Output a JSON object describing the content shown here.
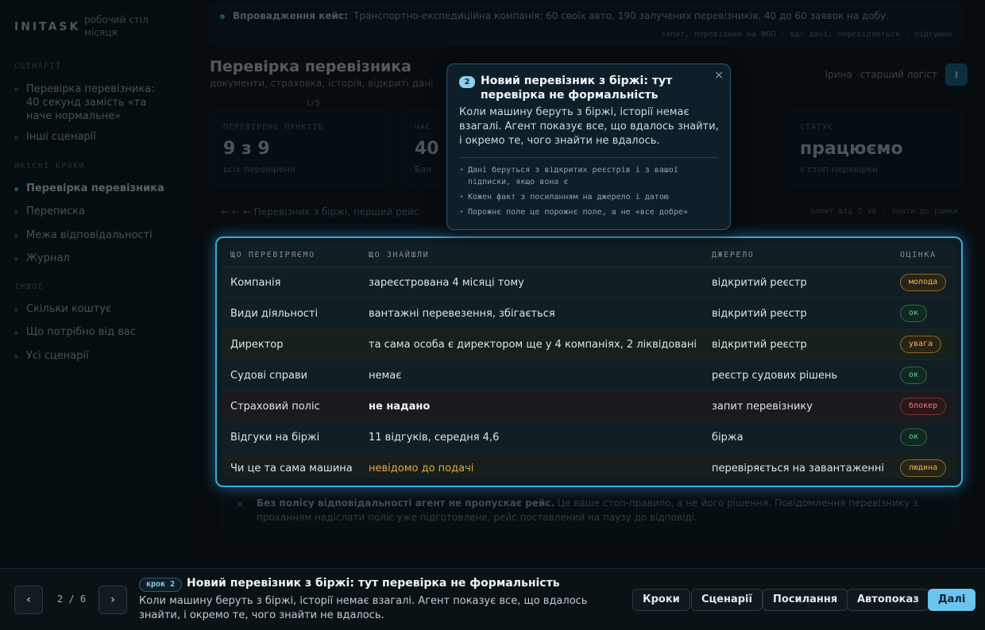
{
  "sidebar": {
    "brand": "INITASK",
    "brand_sub": "робочий стіл\nмісяця",
    "section_scenarios": "СЦЕНАРІЇ",
    "scenario_item": "Перевірка перевізника:\n40 секунд замість «та\nначе нормальне»",
    "scenario_time": "1/5",
    "other_scenarios": "Інші сценарії",
    "section_checks": "ЯКІСНІ КРОКИ",
    "items": [
      {
        "label": "Перевірка перевізника"
      },
      {
        "label": "Переписка"
      },
      {
        "label": "Межа відповідальності"
      },
      {
        "label": "Журнал"
      }
    ],
    "section_more": "ІНШОЕ",
    "more_items": [
      {
        "label": "Скільки коштує"
      },
      {
        "label": "Що потрібно від вас"
      },
      {
        "label": "Усі сценарії"
      }
    ]
  },
  "banner": {
    "title": "Впровадження кейс:",
    "text": "Транспортно-експедиційна компанія: 60 своїх авто, 190 залучених перевізників, 40 до 60 заявок на добу.",
    "meta": "запит, перевізник на ФОП · вщ: дані: перевіряються · підсумок"
  },
  "page": {
    "title": "Перевірка перевізника",
    "subtitle": "документи, страховка, історія, відкриті дані",
    "actions_left": "Ірина",
    "actions_right": "старший логіст",
    "avatar": "І"
  },
  "stats": [
    {
      "label": "ПЕРЕВІРЕНО ПУНКТІВ",
      "value": "9 з 9",
      "note": "всіх перевірено"
    },
    {
      "label": "ЧАС",
      "value": "40",
      "note": "Бал"
    },
    {
      "label": "СТАТУС",
      "value": "працюємо",
      "note": "є стоп-перевірки"
    }
  ],
  "crumb": {
    "left": "← ← ←  Перевізник з біржі, перший рейс",
    "right": "запит від 2 хв · знати до рамки"
  },
  "table": {
    "headers": [
      "ЩО ПЕРЕВІРЯЄМО",
      "ЩО ЗНАЙШЛИ",
      "ДЖЕРЕЛО",
      "ОЦІНКА"
    ],
    "rows": [
      {
        "what": "Компанія",
        "found": "зареєстрована 4 місяці тому",
        "source": "відкритий реєстр",
        "badge": "молода",
        "kind": "young"
      },
      {
        "what": "Види діяльності",
        "found": "вантажні перевезення, збігається",
        "source": "відкритий реєстр",
        "badge": "ок",
        "kind": "ok"
      },
      {
        "what": "Директор",
        "found": "та сама особа є директором ще у 4 компаніях, 2 ліквідовані",
        "source": "відкритий реєстр",
        "badge": "увага",
        "kind": "warn"
      },
      {
        "what": "Судові справи",
        "found": "немає",
        "source": "реєстр судових рішень",
        "badge": "ок",
        "kind": "ok"
      },
      {
        "what": "Страховий поліс",
        "found": "не надано",
        "source": "запит перевізнику",
        "badge": "блокер",
        "kind": "block"
      },
      {
        "what": "Відгуки на біржі",
        "found": "11 відгуків, середня 4,6",
        "source": "біржа",
        "badge": "ок",
        "kind": "ok"
      },
      {
        "what": "Чи це та сама машина",
        "found": "невідомо до подачі",
        "source": "перевіряється на завантаженні",
        "badge": "людина",
        "kind": "human"
      }
    ]
  },
  "footer_note": {
    "bold": "Без полісу відповідальності агент не пропускає рейс.",
    "text": " Це ваше стоп-правило, а не його рішення. Повідомлення перевізнику з проханням надіслати поліс уже підготовлене, рейс поставлений на паузу до відповіді."
  },
  "popover": {
    "num": "2",
    "title": "Новий перевізник з біржі: тут перевірка не формальність",
    "close": "×",
    "body": "Коли машину беруть з біржі, історії немає взагалі. Агент показує все, що вдалось знайти, і окремо те, чого знайти не вдалось.",
    "bullets": [
      "Дані беруться з відкритих реєстрів і з вашої підписки, якщо вона є",
      "Кожен факт з посиланням на джерело і датою",
      "Порожнє поле це порожнє поле, а не «все добре»"
    ]
  },
  "bottom": {
    "prev": "‹",
    "next": "›",
    "counter": "2 / 6",
    "step_tag": "крок 2",
    "step_title": "Новий перевізник з біржі: тут перевірка не формальність",
    "step_body": "Коли машину беруть з біржі, історії немає взагалі. Агент показує все, що вдалось знайти, і окремо те, чого знайти не вдалось.",
    "buttons": {
      "steps": "Кроки",
      "scenarios": "Сценарії",
      "links": "Посилання",
      "autoplay": "Автопоказ",
      "next": "Далі"
    }
  },
  "colors": {
    "accent": "#49c4f0",
    "highlight": "#3aa7de",
    "ok": "#5fd39a",
    "warn": "#e8b454",
    "block": "#ef7b7b"
  }
}
